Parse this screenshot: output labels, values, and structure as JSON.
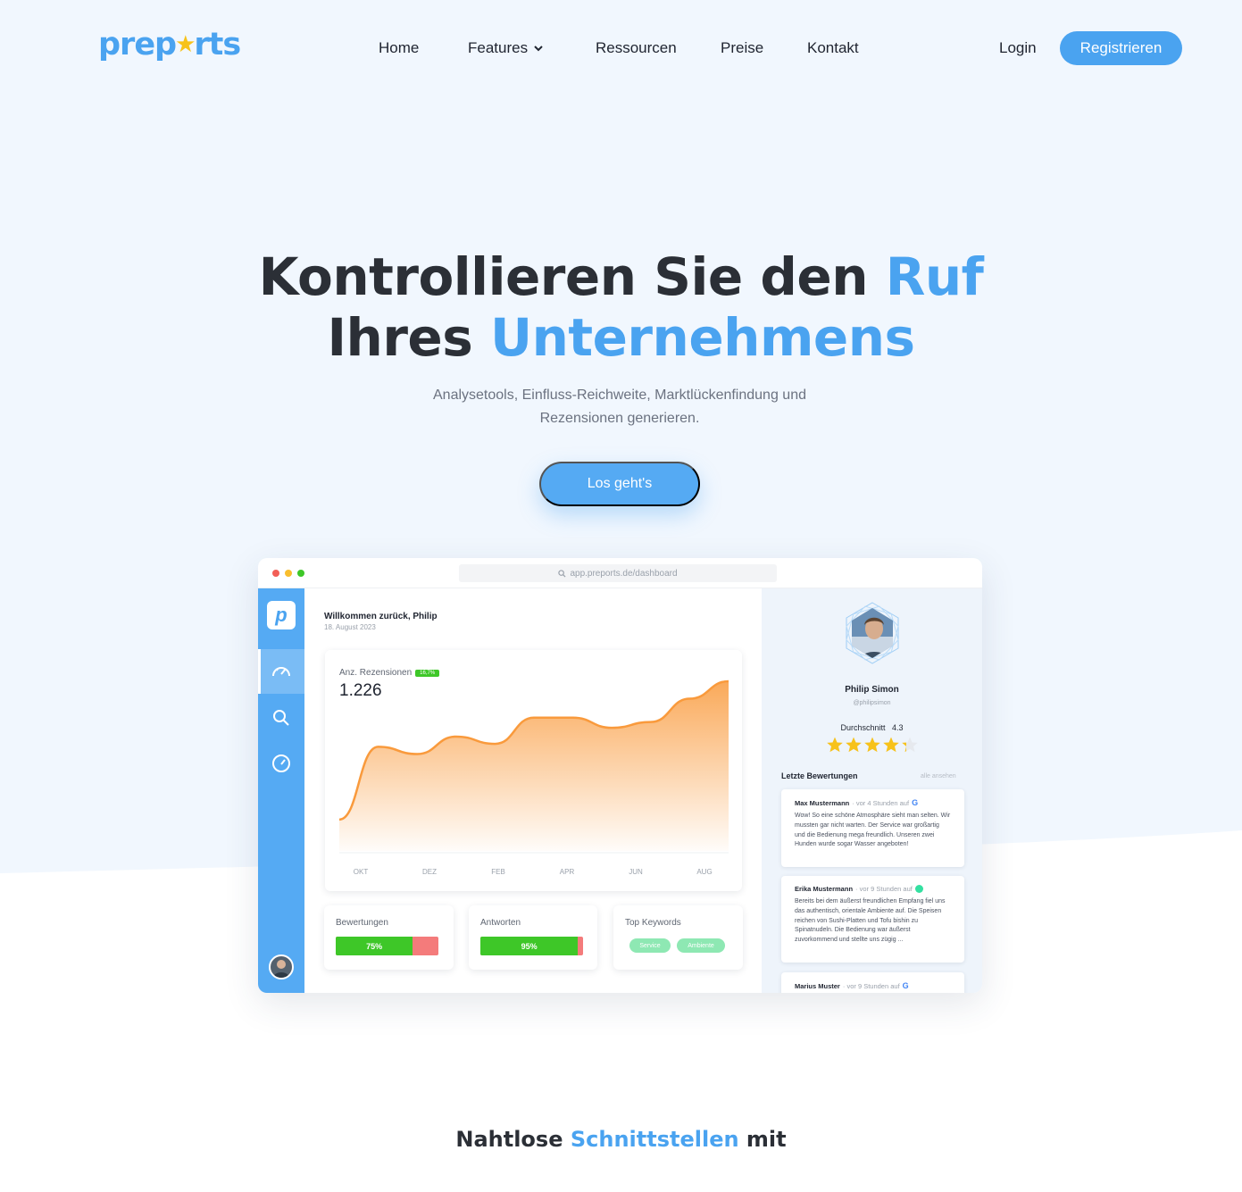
{
  "nav": {
    "logo_left": "prep",
    "logo_right": "rts",
    "items": [
      "Home",
      "Features",
      "Ressourcen",
      "Preise",
      "Kontakt"
    ],
    "login": "Login",
    "register": "Registrieren"
  },
  "hero": {
    "title_line1_a": "Kontrollieren Sie den ",
    "title_line1_b": "Ruf",
    "title_line2_a": "Ihres ",
    "title_line2_b": "Unternehmens",
    "subtitle_line1": "Analysetools, Einfluss-Reichweite, Marktlückenfindung und",
    "subtitle_line2": "Rezensionen generieren.",
    "cta": "Los geht's"
  },
  "dashboard": {
    "url": "app.preports.de/dashboard",
    "welcome": "Willkommen zurück, Philip",
    "date": "18. August 2023",
    "chart": {
      "label": "Anz. Rezensionen",
      "badge": "16,7%",
      "value": "1.226"
    },
    "bewertungen": {
      "title": "Bewertungen",
      "percent": "75%",
      "fraction": 0.75
    },
    "antworten": {
      "title": "Antworten",
      "percent": "95%",
      "fraction": 0.95
    },
    "keywords": {
      "title": "Top Keywords",
      "tags": [
        "Service",
        "Ambiente"
      ]
    }
  },
  "chart_data": {
    "type": "area",
    "x": [
      "OKT",
      "DEZ",
      "FEB",
      "APR",
      "JUN",
      "AUG"
    ],
    "series": [
      {
        "values": [
          0.05,
          0.55,
          0.5,
          0.62,
          0.57,
          0.75,
          0.75,
          0.68,
          0.72,
          0.88,
          1.0
        ]
      }
    ],
    "color": "#f99a3c"
  },
  "profile": {
    "name": "Philip Simon",
    "handle": "@philipsimon",
    "avg_label": "Durchschnitt",
    "avg_value": "4.3",
    "rating": 4.3,
    "recent_title": "Letzte Bewertungen",
    "see_all": "alle ansehen",
    "reviews": [
      {
        "author": "Max Mustermann",
        "meta": "· vor 4 Stunden auf",
        "source": "google-icon",
        "text": "Wow! So eine schöne Atmosphäre sieht man selten. Wir mussten gar nicht warten. Der Service war großartig und die Bedienung mega freundlich. Unseren zwei Hunden wurde sogar Wasser angeboten!"
      },
      {
        "author": "Erika Mustermann",
        "meta": "· vor 9 Stunden auf",
        "source": "tripadvisor-icon",
        "text": "Bereits bei dem äußerst freundlichen Empfang fiel uns das authentisch, orientale Ambiente auf. Die Speisen reichen von Sushi-Platten und Tofu bishin zu Spinatnudeln. Die Bedienung war äußerst zuvorkommend und stellte uns zügig ..."
      },
      {
        "author": "Marius Muster",
        "meta": "· vor 9 Stunden auf",
        "source": "google-icon",
        "text": ""
      }
    ]
  },
  "section2": {
    "title_a": "Nahtlose ",
    "title_b": "Schnittstellen",
    "title_c": " mit"
  },
  "colors": {
    "accent": "#4aa3f0",
    "hero_bg": "#f1f7fe",
    "star": "#f7c21a",
    "chart": "#f99a3c"
  }
}
